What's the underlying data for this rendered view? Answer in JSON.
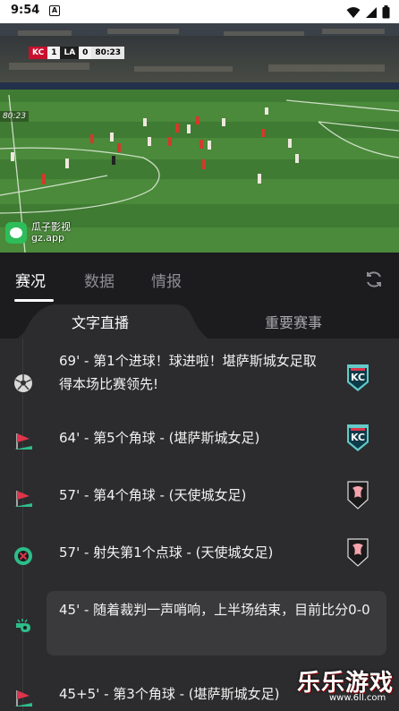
{
  "status_bar": {
    "time": "9:54",
    "notification": "A"
  },
  "video": {
    "score_bug": {
      "team1": "KC",
      "score1": "1",
      "team2": "LA",
      "score2": "0",
      "clock": "80:23"
    },
    "side_clock": "80:23",
    "watermark": {
      "title": "瓜子影视",
      "url": "gz.app"
    }
  },
  "tabs": [
    {
      "label": "赛况",
      "active": true
    },
    {
      "label": "数据",
      "active": false
    },
    {
      "label": "情报",
      "active": false
    }
  ],
  "segments": [
    {
      "label": "文字直播",
      "active": true
    },
    {
      "label": "重要赛事",
      "active": false
    }
  ],
  "events": [
    {
      "icon": "soccer-ball-icon",
      "text": "69' - 第1个进球！球进啦！堪萨斯城女足取得本场比赛领先!",
      "team": "kc"
    },
    {
      "icon": "corner-flag-icon",
      "text": "64' - 第5个角球 - (堪萨斯城女足)",
      "team": "kc"
    },
    {
      "icon": "corner-flag-icon",
      "text": "57' - 第4个角球 - (天使城女足)",
      "team": "la"
    },
    {
      "icon": "penalty-miss-icon",
      "text": "57' - 射失第1个点球 - (天使城女足)",
      "team": "la"
    },
    {
      "icon": "whistle-icon",
      "text": "45' - 随着裁判一声哨响，上半场结束，目前比分0-0",
      "team": ""
    },
    {
      "icon": "corner-flag-icon",
      "text": "45+5' - 第3个角球 - (堪萨斯城女足)",
      "team": "kc"
    }
  ],
  "site_watermark": {
    "title": "乐乐游戏",
    "url": "www.6ll.com"
  },
  "colors": {
    "kc_teal": "#62cbc9",
    "kc_red": "#e0344b",
    "la_black": "#1a1a1a",
    "la_pink": "#f4a3ad",
    "pitch": "#4a8a3a"
  }
}
